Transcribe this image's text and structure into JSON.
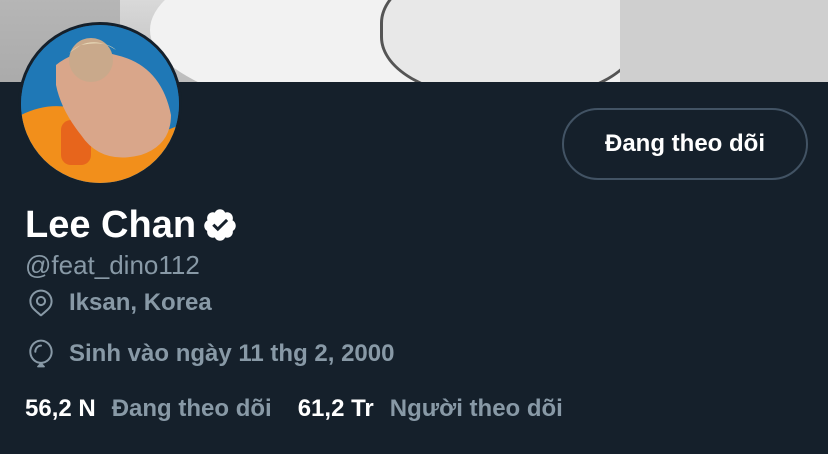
{
  "profile": {
    "display_name": "Lee Chan",
    "handle": "@feat_dino112",
    "location": "Iksan, Korea",
    "birthday": "Sinh vào ngày 11 thg 2, 2000",
    "verified": true
  },
  "actions": {
    "follow_label": "Đang theo dõi"
  },
  "stats": {
    "following_count": "56,2 N",
    "following_label": "Đang theo dõi",
    "followers_count": "61,2 Tr",
    "followers_label": "Người theo dõi"
  },
  "colors": {
    "background": "#15202b",
    "secondary_text": "#8899a6",
    "border": "#425364",
    "verified_badge": "#ffffff"
  },
  "icons": {
    "location": "location-pin-icon",
    "birthday": "balloon-icon",
    "verified": "verified-badge-icon"
  }
}
